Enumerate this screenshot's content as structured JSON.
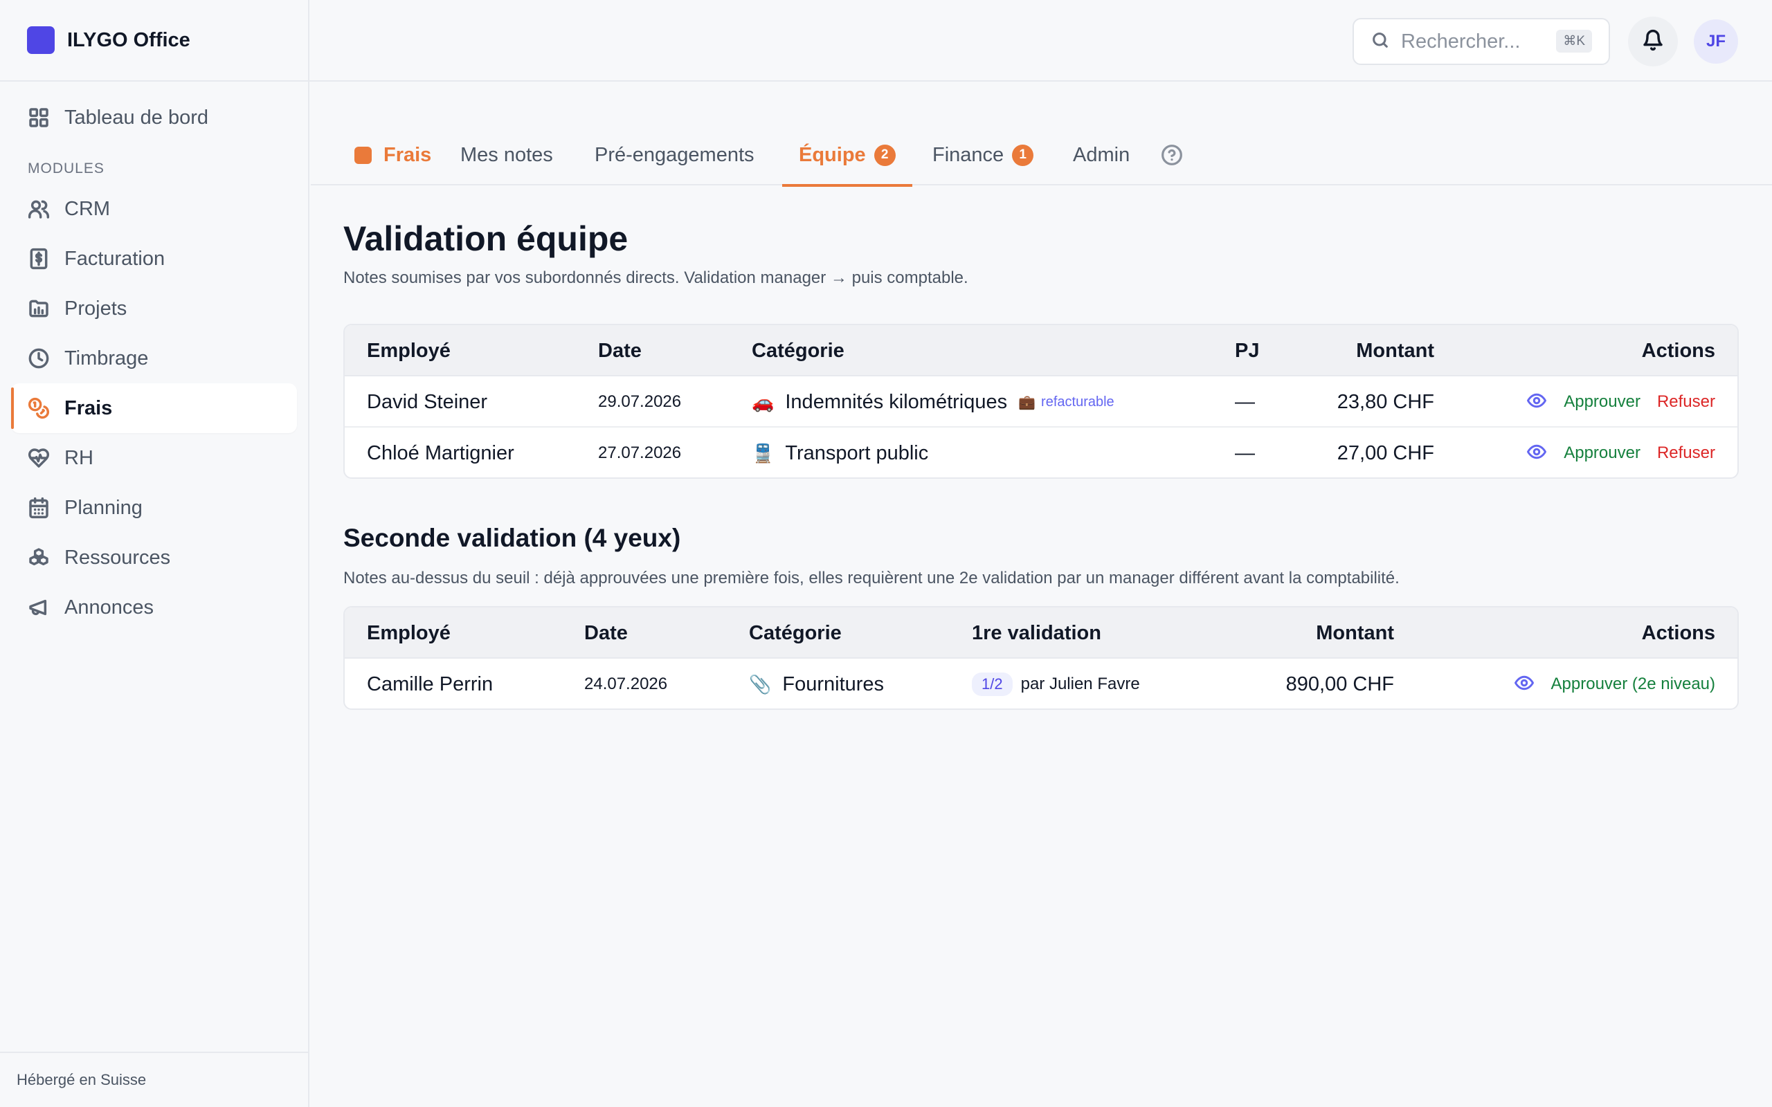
{
  "app": {
    "title": "ILYGO Office"
  },
  "sidebar": {
    "dashboard": {
      "label": "Tableau de bord",
      "icon": "dashboard-icon"
    },
    "section_label": "MODULES",
    "items": [
      {
        "label": "CRM",
        "icon": "users-icon"
      },
      {
        "label": "Facturation",
        "icon": "invoice-icon"
      },
      {
        "label": "Projets",
        "icon": "folder-chart-icon"
      },
      {
        "label": "Timbrage",
        "icon": "clock-icon"
      },
      {
        "label": "Frais",
        "icon": "coins-icon",
        "active": true
      },
      {
        "label": "RH",
        "icon": "heart-pulse-icon"
      },
      {
        "label": "Planning",
        "icon": "calendar-icon"
      },
      {
        "label": "Ressources",
        "icon": "boxes-icon"
      },
      {
        "label": "Annonces",
        "icon": "megaphone-icon"
      }
    ],
    "footer": "Hébergé en Suisse"
  },
  "topbar": {
    "search_placeholder": "Rechercher...",
    "search_shortcut": "⌘K",
    "avatar_initials": "JF"
  },
  "tabs": {
    "module": "Frais",
    "items": [
      {
        "label": "Mes notes"
      },
      {
        "label": "Pré-engagements"
      },
      {
        "label": "Équipe",
        "badge": "2",
        "active": true
      },
      {
        "label": "Finance",
        "badge": "1"
      },
      {
        "label": "Admin"
      }
    ]
  },
  "team_validation": {
    "title": "Validation équipe",
    "subtitle": "Notes soumises par vos subordonnés directs. Validation manager → puis comptable.",
    "columns": {
      "employee": "Employé",
      "date": "Date",
      "category": "Catégorie",
      "attachment": "PJ",
      "amount": "Montant",
      "actions": "Actions"
    },
    "rows": [
      {
        "employee": "David Steiner",
        "date": "29.07.2026",
        "category_icon": "🚗",
        "category": "Indemnités kilométriques",
        "tag": "refacturable",
        "attachment": "—",
        "amount": "23,80 CHF",
        "approve": "Approuver",
        "refuse": "Refuser"
      },
      {
        "employee": "Chloé Martignier",
        "date": "27.07.2026",
        "category_icon": "🚆",
        "category": "Transport public",
        "attachment": "—",
        "amount": "27,00 CHF",
        "approve": "Approuver",
        "refuse": "Refuser"
      }
    ]
  },
  "second_validation": {
    "title": "Seconde validation (4 yeux)",
    "subtitle": "Notes au-dessus du seuil : déjà approuvées une première fois, elles requièrent une 2e validation par un manager différent avant la comptabilité.",
    "columns": {
      "employee": "Employé",
      "date": "Date",
      "category": "Catégorie",
      "first_validation": "1re validation",
      "amount": "Montant",
      "actions": "Actions"
    },
    "rows": [
      {
        "employee": "Camille Perrin",
        "date": "24.07.2026",
        "category_icon": "📎",
        "category": "Fournitures",
        "step": "1/2",
        "validated_by": "par Julien Favre",
        "amount": "890,00 CHF",
        "approve": "Approuver (2e niveau)"
      }
    ]
  },
  "colors": {
    "accent": "#ea7a3a",
    "brand": "#4f46e5",
    "approve": "#15803d",
    "refuse": "#dc2626"
  }
}
